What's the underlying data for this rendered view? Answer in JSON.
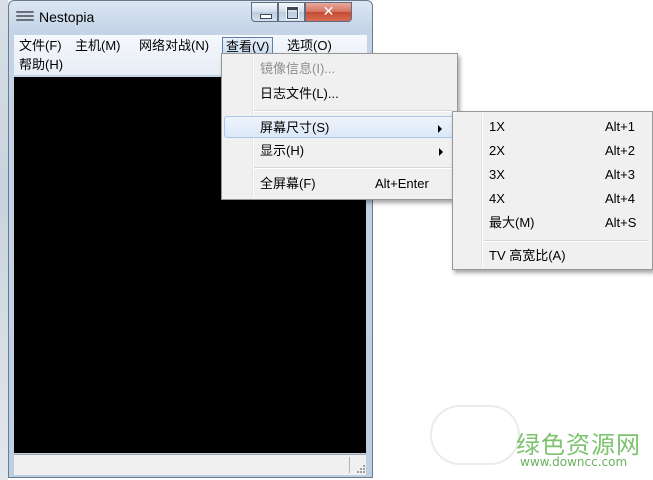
{
  "window": {
    "title": "Nestopia",
    "close_glyph": "✕"
  },
  "menubar": {
    "file": "文件(F)",
    "machine": "主机(M)",
    "netplay": "网络对战(N)",
    "view": "查看(V)",
    "options": "选项(O)",
    "help": "帮助(H)"
  },
  "view_menu": {
    "items": [
      {
        "label": "镜像信息(I)...",
        "shortcut": "",
        "disabled": true
      },
      {
        "label": "日志文件(L)...",
        "shortcut": ""
      },
      {
        "label": "屏幕尺寸(S)",
        "shortcut": "",
        "submenu": true,
        "highlighted": true
      },
      {
        "label": "显示(H)",
        "shortcut": "",
        "submenu": true
      },
      {
        "label": "全屏幕(F)",
        "shortcut": "Alt+Enter"
      }
    ]
  },
  "size_menu": {
    "items": [
      {
        "label": "1X",
        "shortcut": "Alt+1"
      },
      {
        "label": "2X",
        "shortcut": "Alt+2"
      },
      {
        "label": "3X",
        "shortcut": "Alt+3"
      },
      {
        "label": "4X",
        "shortcut": "Alt+4"
      },
      {
        "label": "最大(M)",
        "shortcut": "Alt+S"
      },
      {
        "label": "TV 高宽比(A)",
        "shortcut": ""
      }
    ]
  },
  "watermark": {
    "name": "绿色资源网",
    "url": "www.downcc.com"
  },
  "colors": {
    "content_bg": "#000000",
    "highlight_border": "#a8c8ee",
    "close_button": "#c44b33",
    "watermark_green": "#7cc36e"
  }
}
